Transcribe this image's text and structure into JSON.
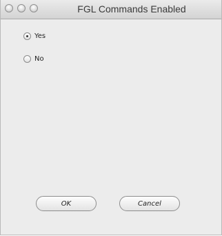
{
  "window": {
    "title": "FGL Commands Enabled"
  },
  "options": [
    {
      "label": "Yes",
      "selected": true
    },
    {
      "label": "No",
      "selected": false
    }
  ],
  "buttons": {
    "ok_label": "OK",
    "cancel_label": "Cancel"
  },
  "colors": {
    "window_background": "#ececec",
    "titlebar_top": "#ebebeb",
    "titlebar_bottom": "#d3d3d3"
  }
}
